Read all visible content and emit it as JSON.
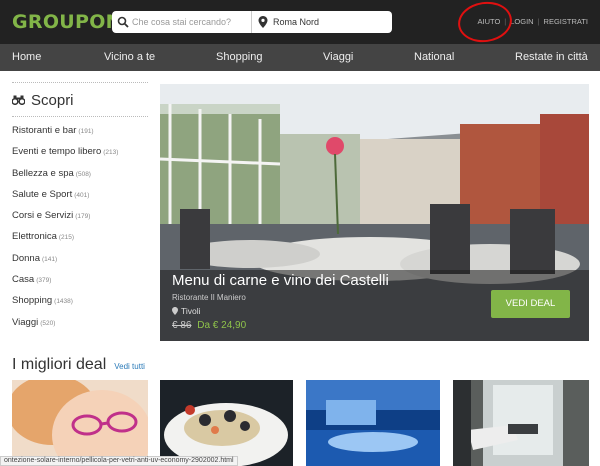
{
  "header": {
    "logo": "GROUPON",
    "search_placeholder": "Che cosa stai cercando?",
    "location_value": "Roma Nord",
    "links": {
      "help": "AIUTO",
      "login": "LOGIN",
      "register": "REGISTRATI"
    }
  },
  "nav": {
    "items": [
      "Home",
      "Vicino a te",
      "Shopping",
      "Viaggi",
      "National",
      "Restate in città"
    ]
  },
  "sidebar": {
    "title": "Scopri",
    "categories": [
      {
        "label": "Ristoranti e bar",
        "count": "(191)"
      },
      {
        "label": "Eventi e tempo libero",
        "count": "(213)"
      },
      {
        "label": "Bellezza e spa",
        "count": "(508)"
      },
      {
        "label": "Salute e Sport",
        "count": "(401)"
      },
      {
        "label": "Corsi e Servizi",
        "count": "(179)"
      },
      {
        "label": "Elettronica",
        "count": "(215)"
      },
      {
        "label": "Donna",
        "count": "(141)"
      },
      {
        "label": "Casa",
        "count": "(379)"
      },
      {
        "label": "Shopping",
        "count": "(1438)"
      },
      {
        "label": "Viaggi",
        "count": "(520)"
      }
    ]
  },
  "featured": {
    "title": "Menu di carne e vino dei Castelli",
    "venue": "Ristorante Il Maniero",
    "location": "Tivoli",
    "old_price": "€ 86",
    "new_price": "Da € 24,90",
    "button": "VEDI DEAL"
  },
  "best_deals": {
    "heading": "I migliori deal",
    "see_all": "Vedi tutti"
  },
  "status_bar": {
    "url": "ontezione-solare-interno/pellicola-per-vetri-anti-uv-economy-2902002.html"
  },
  "colors": {
    "brand": "#82b548",
    "link": "#2a7ab8",
    "annotation": "#e01010"
  }
}
